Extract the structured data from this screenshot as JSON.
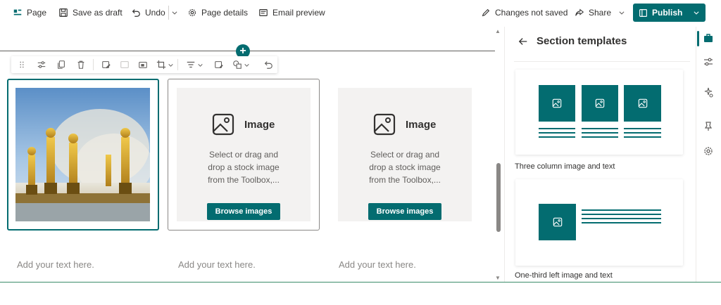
{
  "commandbar": {
    "page": "Page",
    "save_draft": "Save as draft",
    "undo": "Undo",
    "page_details": "Page details",
    "email_preview": "Email preview",
    "changes_status": "Changes not saved",
    "share": "Share",
    "publish": "Publish"
  },
  "canvas": {
    "columns": [
      {
        "type": "image",
        "add_text": "Add your text here."
      },
      {
        "type": "placeholder",
        "title": "Image",
        "description": "Select or drag and drop a stock image from the Toolbox,...",
        "button": "Browse images",
        "add_text": "Add your text here."
      },
      {
        "type": "placeholder",
        "title": "Image",
        "description": "Select or drag and drop a stock image from the Toolbox,...",
        "button": "Browse images",
        "add_text": "Add your text here."
      }
    ]
  },
  "panel": {
    "title": "Section templates",
    "templates": [
      {
        "label": "Three column image and text"
      },
      {
        "label": "One-third left image and text"
      }
    ]
  },
  "colors": {
    "accent": "#036c70",
    "placeholder_bg": "#f3f2f1"
  }
}
